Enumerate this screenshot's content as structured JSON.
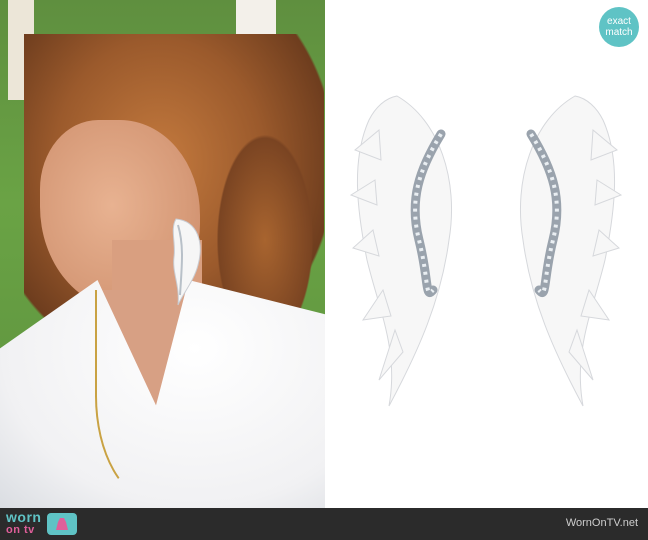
{
  "badge": {
    "line1": "exact",
    "line2": "match",
    "color": "#5fc3c5"
  },
  "footer": {
    "brand_top": "worn",
    "brand_bottom": "on tv",
    "site": "WornOnTV.net",
    "brand_color": "#5fc3c5",
    "accent_color": "#e05f9a",
    "icon": "tv-dress-icon"
  },
  "images": {
    "left": "photo-of-woman-wearing-white-wing-earrings",
    "right": "product-white-wing-earrings"
  }
}
